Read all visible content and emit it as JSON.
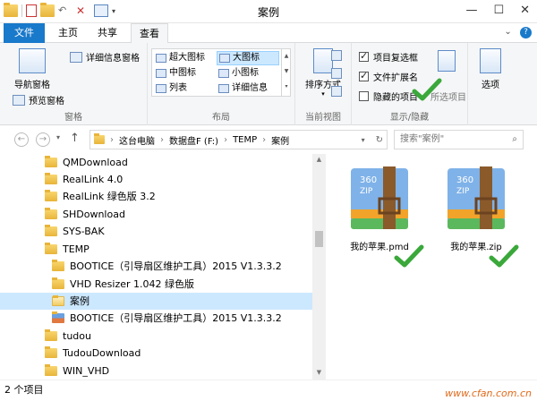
{
  "window": {
    "title": "案例",
    "controls": [
      "—",
      "☐",
      "✕"
    ]
  },
  "ribbon": {
    "tabs": [
      "文件",
      "主页",
      "共享",
      "查看"
    ],
    "active_tab": "查看",
    "panes_group": {
      "label": "窗格",
      "nav_pane": "导航窗格",
      "preview_pane": "预览窗格",
      "details_pane": "详细信息窗格"
    },
    "layout_group": {
      "label": "布局",
      "items": [
        "超大图标",
        "大图标",
        "中图标",
        "小图标",
        "列表",
        "详细信息"
      ],
      "selected": "大图标"
    },
    "current_view_group": {
      "label": "当前视图",
      "sort_by": "排序方式"
    },
    "show_hide_group": {
      "label": "显示/隐藏",
      "item_checkboxes": {
        "label": "项目复选框",
        "checked": true
      },
      "file_extensions": {
        "label": "文件扩展名",
        "checked": true
      },
      "hidden_items": {
        "label": "隐藏的项目",
        "checked": false
      },
      "hide_selected": "所选项目"
    },
    "options": "选项"
  },
  "address": {
    "segments": [
      "这台电脑",
      "数据盘F (F:)",
      "TEMP",
      "案例"
    ],
    "search_placeholder": "搜索\"案例\""
  },
  "tree": {
    "items": [
      {
        "label": "QMDownload",
        "level": 0
      },
      {
        "label": "RealLink 4.0",
        "level": 0
      },
      {
        "label": "RealLink 绿色版 3.2",
        "level": 0
      },
      {
        "label": "SHDownload",
        "level": 0
      },
      {
        "label": "SYS-BAK",
        "level": 0
      },
      {
        "label": "TEMP",
        "level": 0
      },
      {
        "label": "BOOTICE（引导扇区维护工具）2015 V1.3.3.2",
        "level": 1
      },
      {
        "label": "VHD Resizer 1.042 绿色版",
        "level": 1
      },
      {
        "label": "案例",
        "level": 1,
        "selected": true
      },
      {
        "label": "BOOTICE（引导扇区维护工具）2015 V1.3.3.2",
        "level": 1
      },
      {
        "label": "tudou",
        "level": 0
      },
      {
        "label": "TudouDownload",
        "level": 0
      },
      {
        "label": "WIN_VHD",
        "level": 0
      }
    ]
  },
  "files": [
    {
      "name": "我的苹果.pmd"
    },
    {
      "name": "我的苹果.zip"
    }
  ],
  "status": {
    "count": "2 个项目",
    "watermark": "www.cfan.com.cn"
  },
  "colors": {
    "accent": "#1979ca",
    "check_green": "#3aa83a",
    "selection": "#cce8ff"
  }
}
